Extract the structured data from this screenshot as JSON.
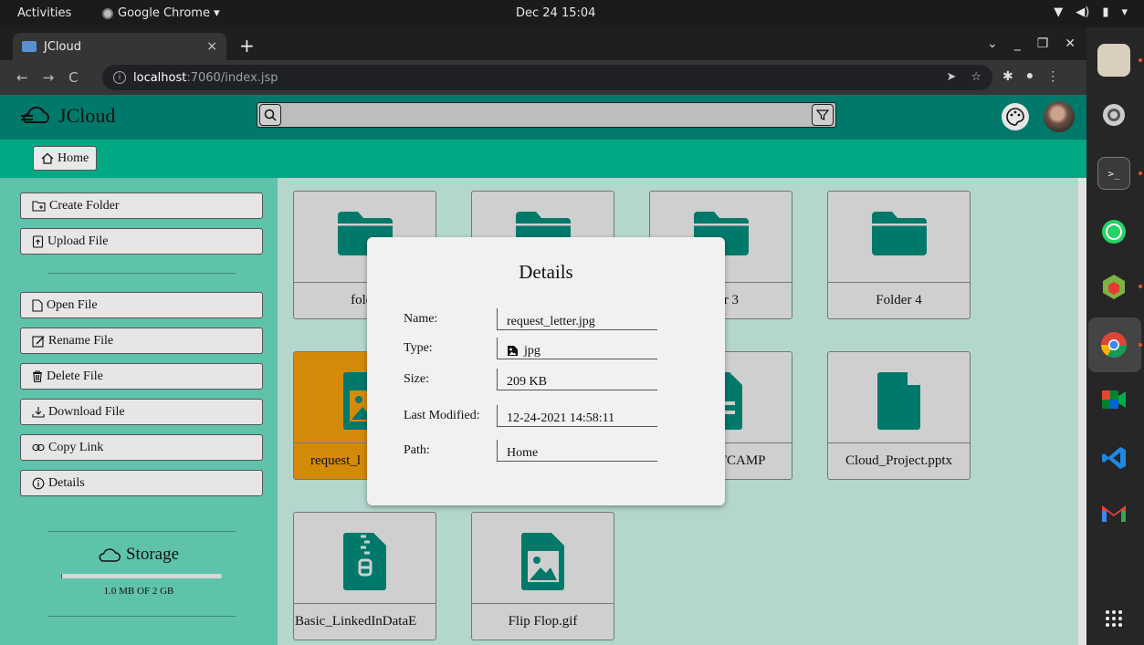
{
  "topbar": {
    "activities": "Activities",
    "app_menu": "Google Chrome ▾",
    "clock": "Dec 24  15:04"
  },
  "browser": {
    "tab_title": "JCloud",
    "tab_close": "×",
    "new_tab": "+",
    "url_host": "localhost",
    "url_path": ":7060/index.jsp",
    "nav": {
      "back": "←",
      "forward": "→",
      "reload": "C"
    }
  },
  "app": {
    "title": "JCloud",
    "search": {
      "value": "",
      "placeholder": ""
    }
  },
  "breadcrumb": {
    "home": "Home"
  },
  "sidebar": {
    "create_folder": "Create Folder",
    "upload_file": "Upload File",
    "open_file": "Open File",
    "rename_file": "Rename File",
    "delete_file": "Delete File",
    "download_file": "Download File",
    "copy_link": "Copy Link",
    "details": "Details",
    "storage_title": "Storage",
    "storage_used_fraction": 0.0005,
    "storage_text": "1.0 MB OF 2 GB"
  },
  "files": [
    {
      "name": "folde",
      "type": "folder"
    },
    {
      "name": "",
      "type": "folder"
    },
    {
      "name": "er 3",
      "type": "folder"
    },
    {
      "name": "Folder 4",
      "type": "folder"
    },
    {
      "name": "request_l",
      "type": "image",
      "selected": true
    },
    {
      "name": "",
      "type": "hidden"
    },
    {
      "name": "OTCAMP",
      "type": "spreadsheet"
    },
    {
      "name": "Cloud_Project.pptx",
      "type": "doc"
    },
    {
      "name": "Basic_LinkedInDataE",
      "type": "zip"
    },
    {
      "name": "Flip Flop.gif",
      "type": "image"
    }
  ],
  "details": {
    "title": "Details",
    "name_label": "Name:",
    "name_value": "request_letter.jpg",
    "type_label": "Type:",
    "type_value": "jpg",
    "size_label": "Size:",
    "size_value": "209 KB",
    "modified_label": "Last Modified:",
    "modified_value": "12-24-2021 14:58:11",
    "path_label": "Path:",
    "path_value": "Home"
  },
  "colors": {
    "header": "#00796b",
    "crumbbar": "#00a884",
    "icon": "#00796b",
    "selected": "#d48a09"
  }
}
